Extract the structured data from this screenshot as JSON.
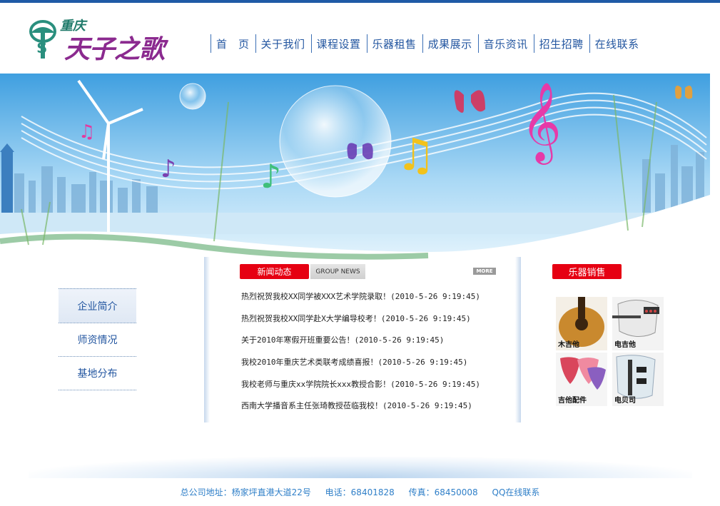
{
  "logo": {
    "city": "重庆",
    "brand": "天子之歌"
  },
  "nav": {
    "items": [
      {
        "label": "首　页"
      },
      {
        "label": "关于我们"
      },
      {
        "label": "课程设置"
      },
      {
        "label": "乐器租售"
      },
      {
        "label": "成果展示"
      },
      {
        "label": "音乐资讯"
      },
      {
        "label": "招生招聘"
      },
      {
        "label": "在线联系"
      }
    ]
  },
  "side_menu": {
    "items": [
      {
        "label": "企业简介"
      },
      {
        "label": "师资情况"
      },
      {
        "label": "基地分布"
      }
    ]
  },
  "news": {
    "title": "新闻动态",
    "subtitle": "GROUP NEWS",
    "more": "MORE",
    "items": [
      {
        "text": "热烈祝贺我校XX同学被XXX艺术学院录取！(2010-5-26 9:19:45)"
      },
      {
        "text": "热烈祝贺我校XX同学赴X大学编导校考！(2010-5-26 9:19:45)"
      },
      {
        "text": "关于2010年寒假开班重要公告！(2010-5-26 9:19:45)"
      },
      {
        "text": "我校2010年重庆艺术类联考成绩喜报！(2010-5-26 9:19:45)"
      },
      {
        "text": "我校老师与重庆xx学院院长xxx教授合影！(2010-5-26 9:19:45)"
      },
      {
        "text": "西南大学播音系主任张琦教授莅临我校！(2010-5-26 9:19:45)"
      }
    ]
  },
  "instruments": {
    "title": "乐器销售",
    "items": [
      {
        "label": "木吉他"
      },
      {
        "label": "电吉他"
      },
      {
        "label": "吉他配件"
      },
      {
        "label": "电贝司"
      }
    ]
  },
  "footer": {
    "address": "总公司地址：杨家坪直港大道22号",
    "phone": "电话：68401828",
    "fax": "传真：68450008",
    "qq": "QQ在线联系"
  },
  "colors": {
    "nav_text": "#2356a0",
    "accent_red": "#e60012",
    "footer_text": "#2f7fc8"
  }
}
